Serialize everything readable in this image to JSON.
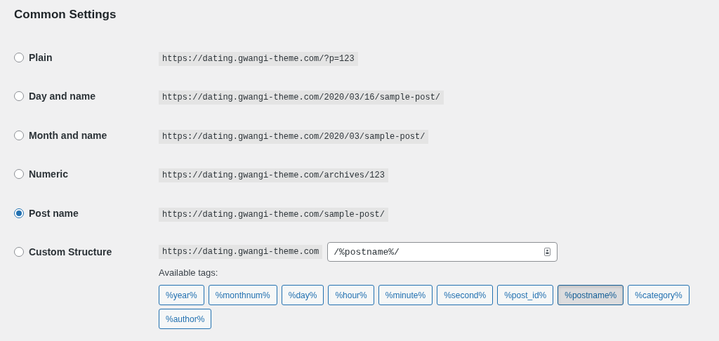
{
  "heading": "Common Settings",
  "options": [
    {
      "label": "Plain",
      "example": "https://dating.gwangi-theme.com/?p=123",
      "selected": false,
      "kind": "example"
    },
    {
      "label": "Day and name",
      "example": "https://dating.gwangi-theme.com/2020/03/16/sample-post/",
      "selected": false,
      "kind": "example"
    },
    {
      "label": "Month and name",
      "example": "https://dating.gwangi-theme.com/2020/03/sample-post/",
      "selected": false,
      "kind": "example"
    },
    {
      "label": "Numeric",
      "example": "https://dating.gwangi-theme.com/archives/123",
      "selected": false,
      "kind": "example"
    },
    {
      "label": "Post name",
      "example": "https://dating.gwangi-theme.com/sample-post/",
      "selected": true,
      "kind": "example"
    },
    {
      "label": "Custom Structure",
      "example": "https://dating.gwangi-theme.com",
      "selected": false,
      "kind": "custom",
      "value": "/%postname%/"
    }
  ],
  "available_tags": {
    "label": "Available tags:",
    "tags": [
      {
        "label": "%year%",
        "selected": false
      },
      {
        "label": "%monthnum%",
        "selected": false
      },
      {
        "label": "%day%",
        "selected": false
      },
      {
        "label": "%hour%",
        "selected": false
      },
      {
        "label": "%minute%",
        "selected": false
      },
      {
        "label": "%second%",
        "selected": false
      },
      {
        "label": "%post_id%",
        "selected": false
      },
      {
        "label": "%postname%",
        "selected": true
      },
      {
        "label": "%category%",
        "selected": false
      },
      {
        "label": "%author%",
        "selected": false
      }
    ]
  }
}
